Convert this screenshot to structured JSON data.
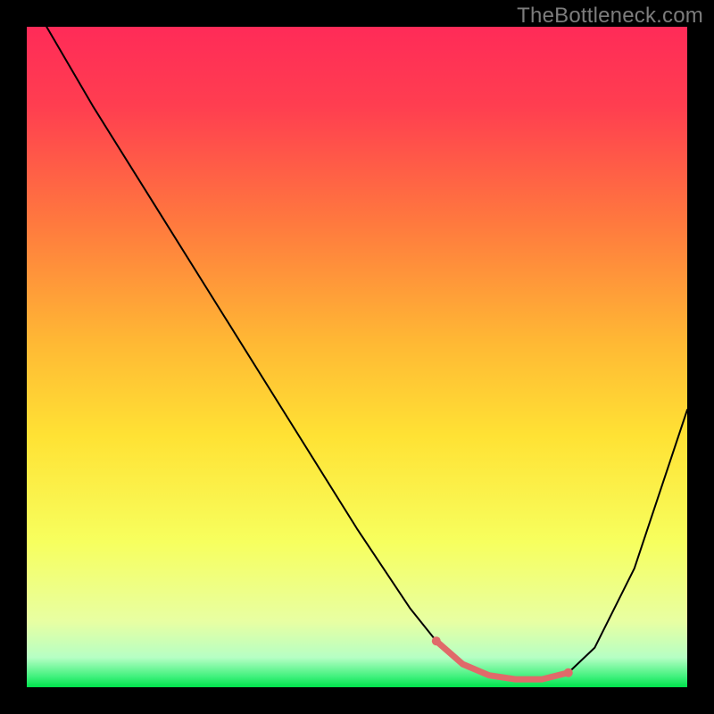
{
  "watermark": "TheBottleneck.com",
  "chart_data": {
    "type": "line",
    "title": "",
    "xlabel": "",
    "ylabel": "",
    "xlim": [
      0,
      100
    ],
    "ylim": [
      0,
      100
    ],
    "grid": false,
    "legend": false,
    "background_gradient": {
      "top_color": "#ff2b58",
      "mid_colors": [
        "#ff6d3f",
        "#ffb334",
        "#ffe534",
        "#f6ff66",
        "#d8ffb8"
      ],
      "bottom_color": "#00e64d"
    },
    "series": [
      {
        "name": "bottleneck-curve",
        "stroke": "#000000",
        "stroke_width": 2,
        "x": [
          3,
          10,
          20,
          30,
          40,
          50,
          58,
          62,
          66,
          70,
          74,
          78,
          82,
          86,
          92,
          100
        ],
        "values": [
          100,
          88,
          72,
          56,
          40,
          24,
          12,
          7,
          3.5,
          1.8,
          1.2,
          1.2,
          2.2,
          6,
          18,
          42
        ]
      },
      {
        "name": "optimal-band",
        "stroke": "#e06a6a",
        "stroke_width": 7,
        "x": [
          62,
          66,
          70,
          74,
          78,
          82
        ],
        "values": [
          7,
          3.5,
          1.8,
          1.2,
          1.2,
          2.2
        ]
      }
    ],
    "markers": [
      {
        "name": "optimal-start",
        "x": 62,
        "y": 7,
        "r": 5,
        "fill": "#e06a6a"
      },
      {
        "name": "optimal-end",
        "x": 82,
        "y": 2.2,
        "r": 5,
        "fill": "#e06a6a"
      }
    ]
  }
}
